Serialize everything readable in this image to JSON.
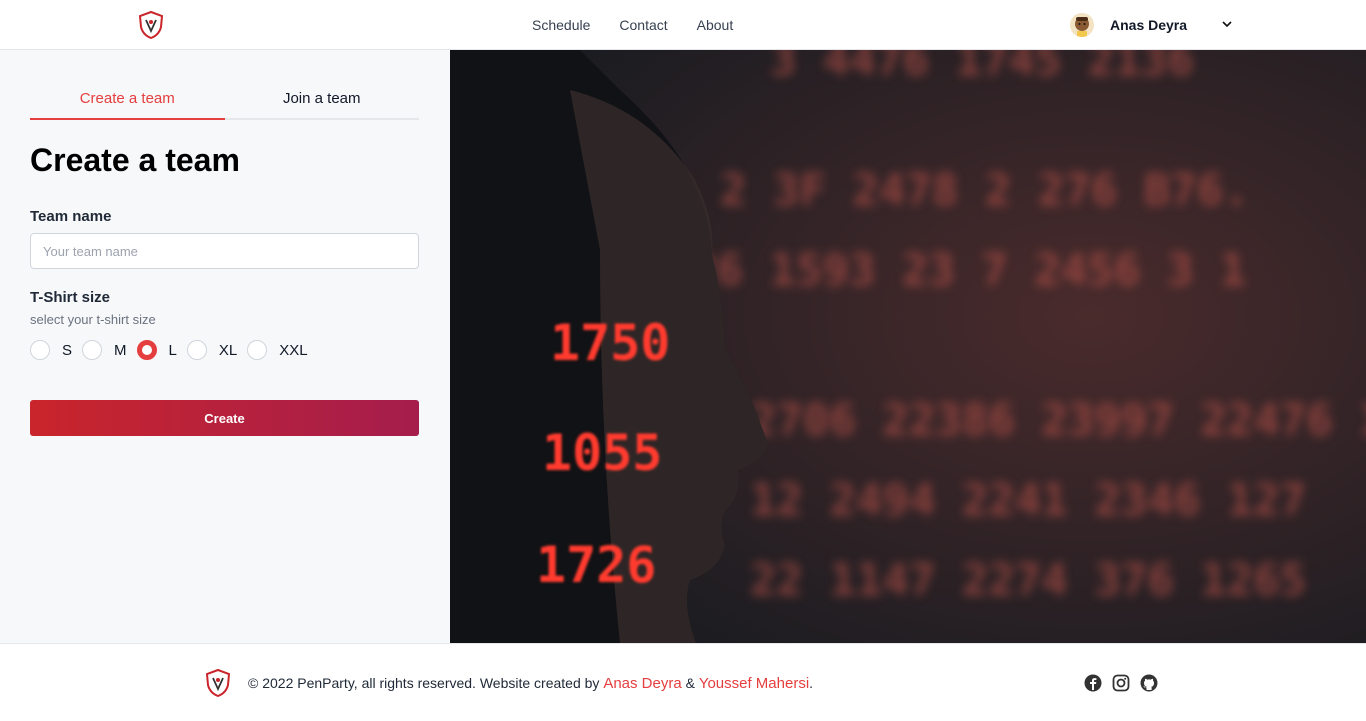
{
  "header": {
    "nav": [
      "Schedule",
      "Contact",
      "About"
    ],
    "user_name": "Anas Deyra"
  },
  "tabs": {
    "create": "Create a team",
    "join": "Join a team"
  },
  "form": {
    "title": "Create a team",
    "team_name_label": "Team name",
    "team_name_placeholder": "Your team name",
    "team_name_value": "",
    "shirt_label": "T-Shirt size",
    "shirt_hint": "select your t-shirt size",
    "sizes": [
      "S",
      "M",
      "L",
      "XL",
      "XXL"
    ],
    "selected_size": "L",
    "submit_label": "Create"
  },
  "hero_numbers": [
    "1750",
    "1055",
    "1726"
  ],
  "footer": {
    "copyright": "© 2022 PenParty, all rights reserved. Website created by",
    "author1": "Anas Deyra",
    "amp": "&",
    "author2": "Youssef Mahersi",
    "period": "."
  },
  "colors": {
    "accent": "#e53e3e",
    "button_start": "#c9252b",
    "button_end": "#a51d4d"
  },
  "icons": [
    "penparty-logo",
    "chevron-down-icon",
    "facebook-icon",
    "instagram-icon",
    "github-icon"
  ]
}
